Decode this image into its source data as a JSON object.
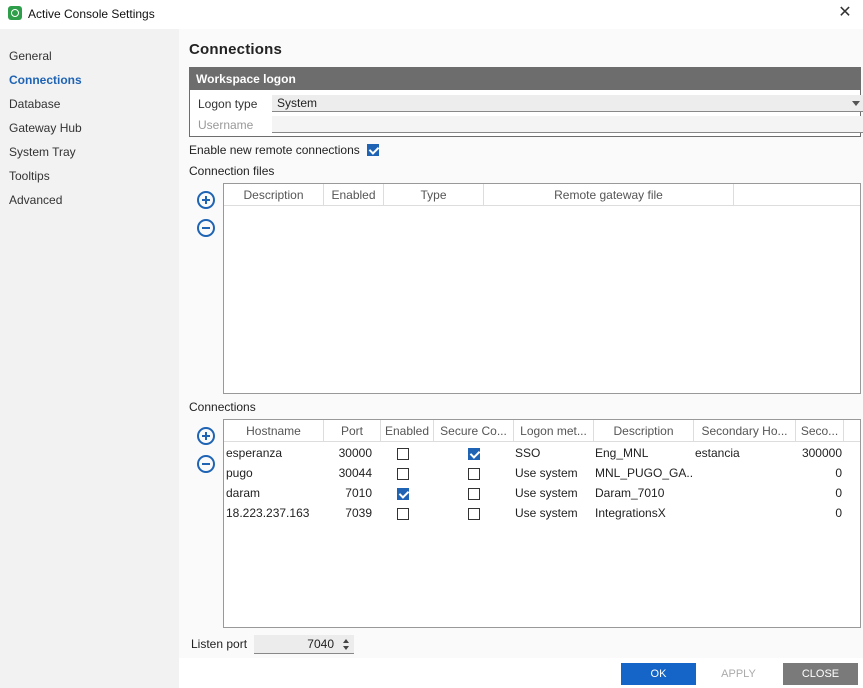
{
  "window": {
    "title": "Active Console Settings"
  },
  "sidebar": {
    "items": [
      {
        "label": "General",
        "active": false
      },
      {
        "label": "Connections",
        "active": true
      },
      {
        "label": "Database",
        "active": false
      },
      {
        "label": "Gateway Hub",
        "active": false
      },
      {
        "label": "System Tray",
        "active": false
      },
      {
        "label": "Tooltips",
        "active": false
      },
      {
        "label": "Advanced",
        "active": false
      }
    ]
  },
  "main": {
    "title": "Connections",
    "workspace_logon": {
      "header": "Workspace logon",
      "logon_type_label": "Logon type",
      "logon_type_value": "System",
      "username_label": "Username",
      "username_value": ""
    },
    "enable_remote": {
      "label": "Enable new remote connections",
      "checked": true
    },
    "connection_files": {
      "label": "Connection files",
      "columns": [
        "Description",
        "Enabled",
        "Type",
        "Remote gateway file"
      ],
      "rows": []
    },
    "connections": {
      "label": "Connections",
      "columns": [
        "Hostname",
        "Port",
        "Enabled",
        "Secure Co...",
        "Logon met...",
        "Description",
        "Secondary Ho...",
        "Seco..."
      ],
      "rows": [
        {
          "hostname": "esperanza",
          "port": "30000",
          "enabled": false,
          "secure": true,
          "logon": "SSO",
          "description": "Eng_MNL",
          "secondary_host": "estancia",
          "secondary_port": "300000"
        },
        {
          "hostname": "pugo",
          "port": "30044",
          "enabled": false,
          "secure": false,
          "logon": "Use system",
          "description": "MNL_PUGO_GA...",
          "secondary_host": "",
          "secondary_port": "0"
        },
        {
          "hostname": "daram",
          "port": "7010",
          "enabled": true,
          "secure": false,
          "logon": "Use system",
          "description": "Daram_7010",
          "secondary_host": "",
          "secondary_port": "0"
        },
        {
          "hostname": "18.223.237.163",
          "port": "7039",
          "enabled": false,
          "secure": false,
          "logon": "Use system",
          "description": "IntegrationsX",
          "secondary_host": "",
          "secondary_port": "0"
        }
      ]
    },
    "listen_port": {
      "label": "Listen port",
      "value": "7040"
    }
  },
  "footer": {
    "ok_label": "OK",
    "apply_label": "APPLY",
    "close_label": "CLOSE"
  },
  "colors": {
    "accent": "#1f64b4",
    "header_gray": "#6d6d6d",
    "close_gray": "#7a7a7a"
  }
}
